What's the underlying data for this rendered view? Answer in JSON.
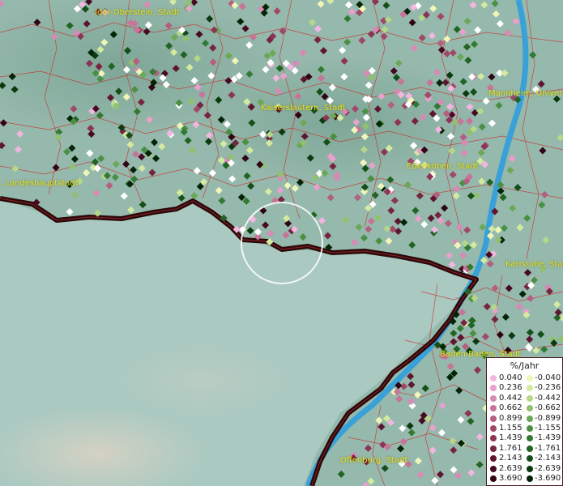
{
  "map": {
    "cities": [
      {
        "label": "Idar-Oberstein, Stadt"
      },
      {
        "label": "Kaiserslautern, Stadt"
      },
      {
        "label": "Mannheim, Universitätsstadt"
      },
      {
        "label": "Edenkoben, Stadt"
      },
      {
        "label": ", Landeshauptstadt"
      },
      {
        "label": "Karlsruhe, Stadt"
      },
      {
        "label": "Baden-Baden, Stadt"
      },
      {
        "label": "Offenburg, Stadt"
      }
    ]
  },
  "legend": {
    "title": "%/Jahr",
    "positive": [
      {
        "value": "0.040",
        "color": "#f2b6e0"
      },
      {
        "value": "0.236",
        "color": "#e8a0cc"
      },
      {
        "value": "0.442",
        "color": "#d88ab4"
      },
      {
        "value": "0.662",
        "color": "#c87398"
      },
      {
        "value": "0.899",
        "color": "#b45e80"
      },
      {
        "value": "1.155",
        "color": "#a04868"
      },
      {
        "value": "1.439",
        "color": "#8c3454"
      },
      {
        "value": "1.761",
        "color": "#762440"
      },
      {
        "value": "2.143",
        "color": "#5e1530"
      },
      {
        "value": "2.639",
        "color": "#480a22"
      },
      {
        "value": "3.690",
        "color": "#300414"
      }
    ],
    "negative": [
      {
        "value": "-0.040",
        "color": "#f0f6b8"
      },
      {
        "value": "-0.236",
        "color": "#d4ea9e"
      },
      {
        "value": "-0.442",
        "color": "#b4d888"
      },
      {
        "value": "-0.662",
        "color": "#90c070"
      },
      {
        "value": "-0.899",
        "color": "#6ca858"
      },
      {
        "value": "-1.155",
        "color": "#4a9044"
      },
      {
        "value": "-1.439",
        "color": "#327a32"
      },
      {
        "value": "-1.761",
        "color": "#226424"
      },
      {
        "value": "-2.143",
        "color": "#144e18"
      },
      {
        "value": "-2.639",
        "color": "#0a3a0e"
      },
      {
        "value": "-3.690",
        "color": "#032406"
      }
    ]
  },
  "colors": {
    "terrain": "#9cbcb4",
    "river": "#3aa0d8",
    "border": "#2a0808",
    "district_lines": "#d02020",
    "city_label": "#e8e61a"
  }
}
